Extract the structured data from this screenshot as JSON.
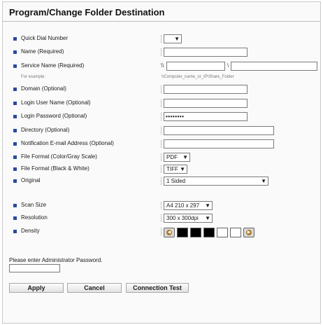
{
  "page": {
    "title": "Program/Change Folder Destination"
  },
  "fields": {
    "quick_dial_number": {
      "label": "Quick Dial Number",
      "value": ""
    },
    "name": {
      "label": "Name (Required)",
      "value": ""
    },
    "service_name": {
      "label": "Service Name (Required)",
      "prefix": "\\\\",
      "separator": "\\",
      "value_computer": "",
      "value_share": "",
      "example_label": "For example:",
      "example_value": "\\\\Computer_name_or_IP\\Share_Folder"
    },
    "domain": {
      "label": "Domain (Optional)",
      "value": ""
    },
    "login_user_name": {
      "label": "Login User Name (Optional)",
      "value": ""
    },
    "login_password": {
      "label": "Login Password (Optional)",
      "value": "••••••••"
    },
    "directory": {
      "label": "Directory (Optional)",
      "value": ""
    },
    "notification_email": {
      "label": "Notification E-mail Address (Optional)",
      "value": ""
    },
    "file_format_color": {
      "label": "File Format (Color/Gray Scale)",
      "value": "PDF"
    },
    "file_format_bw": {
      "label": "File Format (Black & White)",
      "value": "TIFF"
    },
    "original": {
      "label": "Original",
      "value": "1 Sided"
    },
    "scan_size": {
      "label": "Scan Size",
      "value": "A4 210 x 297"
    },
    "resolution": {
      "label": "Resolution",
      "value": "300 x 300dpi"
    },
    "density": {
      "label": "Density",
      "cells": [
        "#000000",
        "#000000",
        "#000000",
        "#ffffff",
        "#ffffff"
      ]
    }
  },
  "admin": {
    "prompt": "Please enter Administrator Password.",
    "password_value": ""
  },
  "buttons": {
    "apply": "Apply",
    "cancel": "Cancel",
    "connection_test": "Connection Test"
  },
  "colors": {
    "bullet": "#2b4aa0",
    "density_arrow": "#b07a24"
  }
}
